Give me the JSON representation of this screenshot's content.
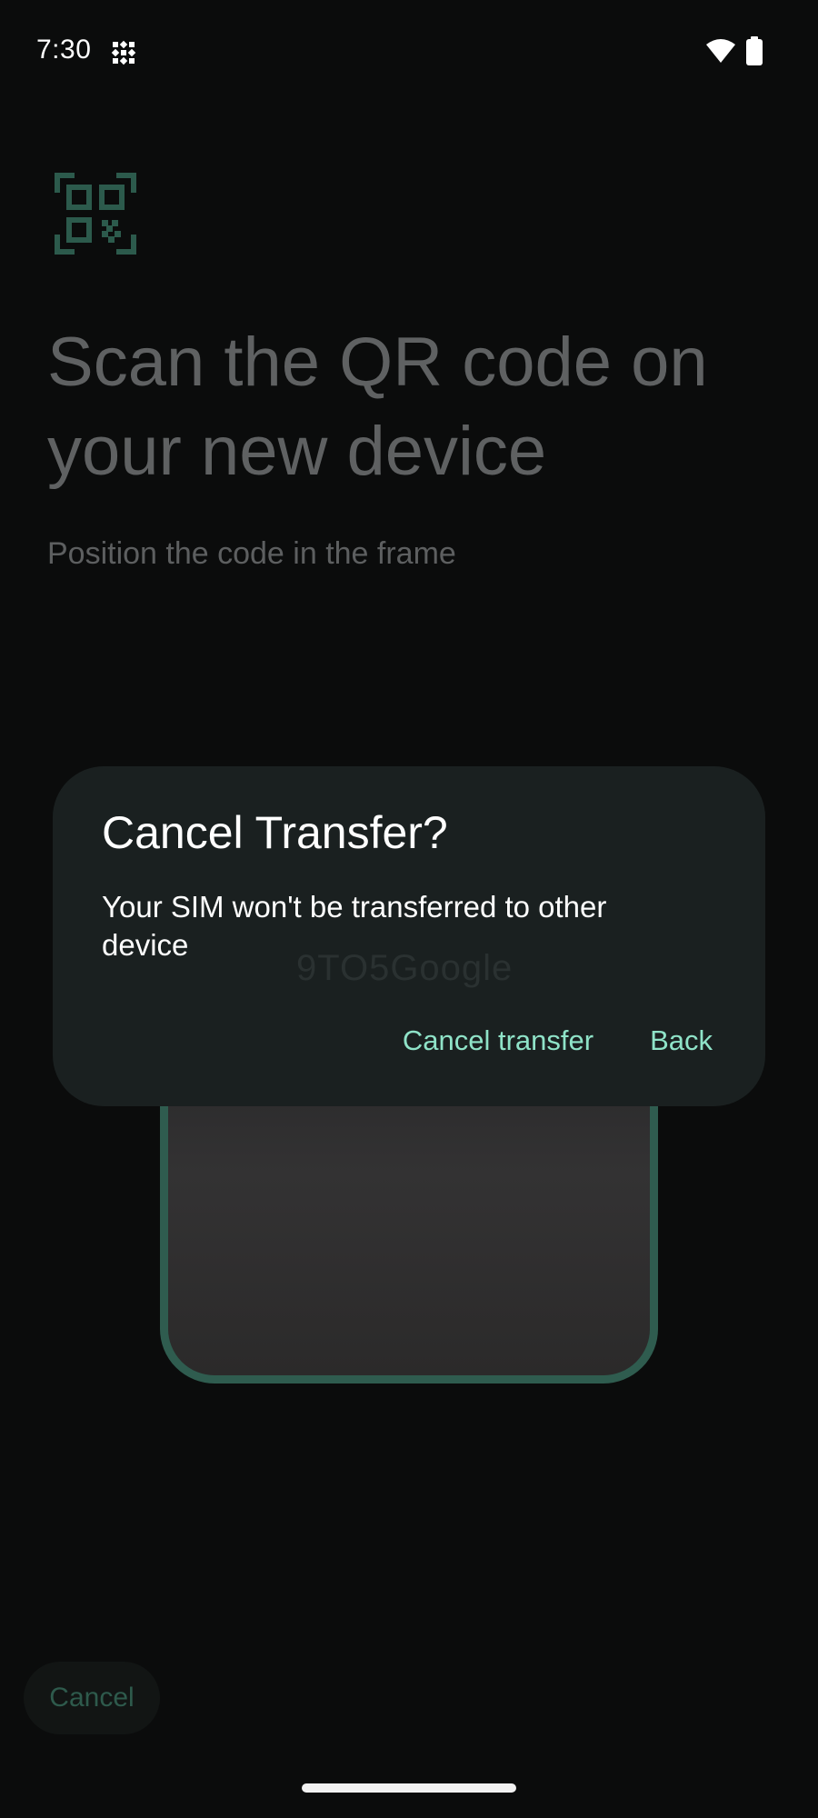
{
  "status_bar": {
    "time": "7:30",
    "icons": [
      "notification-icon",
      "wifi-icon",
      "battery-icon"
    ]
  },
  "page": {
    "icon": "qr-code-icon",
    "title": "Scan the QR code on your new device",
    "subtitle": "Position the code in the frame",
    "cancel_label": "Cancel"
  },
  "dialog": {
    "title": "Cancel Transfer?",
    "body": "Your SIM won't be transferred to other device",
    "watermark": "9TO5Google",
    "actions": {
      "cancel_transfer": "Cancel transfer",
      "back": "Back"
    }
  },
  "colors": {
    "background": "#0b0c0c",
    "dialog_surface": "#1a2020",
    "accent": "#8fe3c8",
    "frame_border": "#2f5c4f"
  }
}
